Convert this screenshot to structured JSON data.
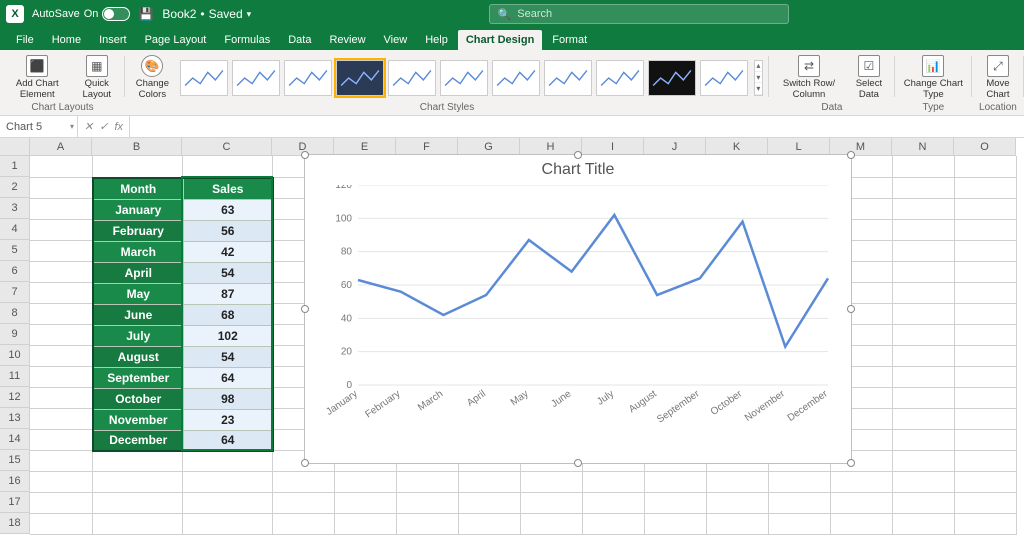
{
  "title_bar": {
    "autosave_label": "AutoSave",
    "autosave_on": "On",
    "doc_name": "Book2",
    "doc_status": "Saved",
    "search_placeholder": "Search"
  },
  "menu_tabs": [
    "File",
    "Home",
    "Insert",
    "Page Layout",
    "Formulas",
    "Data",
    "Review",
    "View",
    "Help",
    "Chart Design",
    "Format"
  ],
  "menu_active": "Chart Design",
  "ribbon": {
    "groups": {
      "chart_layouts": {
        "label": "Chart Layouts",
        "add_element": "Add Chart\nElement",
        "quick_layout": "Quick\nLayout"
      },
      "chart_styles": {
        "label": "Chart Styles",
        "change_colors": "Change\nColors"
      },
      "data": {
        "label": "Data",
        "switch": "Switch Row/\nColumn",
        "select": "Select\nData"
      },
      "type": {
        "label": "Type",
        "change_type": "Change\nChart Type"
      },
      "location": {
        "label": "Location",
        "move": "Move\nChart"
      }
    }
  },
  "namebox_value": "Chart 5",
  "columns": [
    "A",
    "B",
    "C",
    "D",
    "E",
    "F",
    "G",
    "H",
    "I",
    "J",
    "K",
    "L",
    "M",
    "N",
    "O"
  ],
  "row_count": 18,
  "data_table": {
    "headers": [
      "Month",
      "Sales"
    ],
    "rows": [
      [
        "January",
        63
      ],
      [
        "February",
        56
      ],
      [
        "March",
        42
      ],
      [
        "April",
        54
      ],
      [
        "May",
        87
      ],
      [
        "June",
        68
      ],
      [
        "July",
        102
      ],
      [
        "August",
        54
      ],
      [
        "September",
        64
      ],
      [
        "October",
        98
      ],
      [
        "November",
        23
      ],
      [
        "December",
        64
      ]
    ]
  },
  "chart_data": {
    "type": "line",
    "title": "Chart Title",
    "xlabel": "",
    "ylabel": "",
    "categories": [
      "January",
      "February",
      "March",
      "April",
      "May",
      "June",
      "July",
      "August",
      "September",
      "October",
      "November",
      "December"
    ],
    "values": [
      63,
      56,
      42,
      54,
      87,
      68,
      102,
      54,
      64,
      98,
      23,
      64
    ],
    "ylim": [
      0,
      120
    ],
    "yticks": [
      0,
      20,
      40,
      60,
      80,
      100,
      120
    ],
    "grid": true,
    "legend": false
  }
}
